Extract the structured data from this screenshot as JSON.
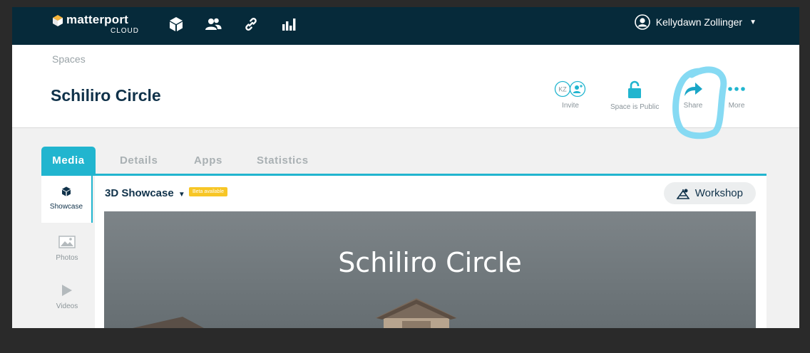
{
  "brand": {
    "name": "matterport",
    "sub": "CLOUD"
  },
  "nav": {
    "icons": [
      "cube-icon",
      "users-icon",
      "link-icon",
      "bar-chart-icon"
    ],
    "user_name": "Kellydawn Zollinger"
  },
  "breadcrumb": "Spaces",
  "space_title": "Schiliro Circle",
  "actions": {
    "invite_initials": "KZ",
    "invite": "Invite",
    "public": "Space is Public",
    "share": "Share",
    "more": "More"
  },
  "tabs": [
    "Media",
    "Details",
    "Apps",
    "Statistics"
  ],
  "side_nav": [
    "Showcase",
    "Photos",
    "Videos"
  ],
  "showcase": {
    "title": "3D Showcase",
    "beta": "Beta available",
    "workshop": "Workshop",
    "preview_title": "Schiliro Circle"
  },
  "colors": {
    "accent": "#21b5cf",
    "nav_bg": "#062a3a",
    "beta": "#f7c626",
    "highlight": "#7fd8f2"
  }
}
